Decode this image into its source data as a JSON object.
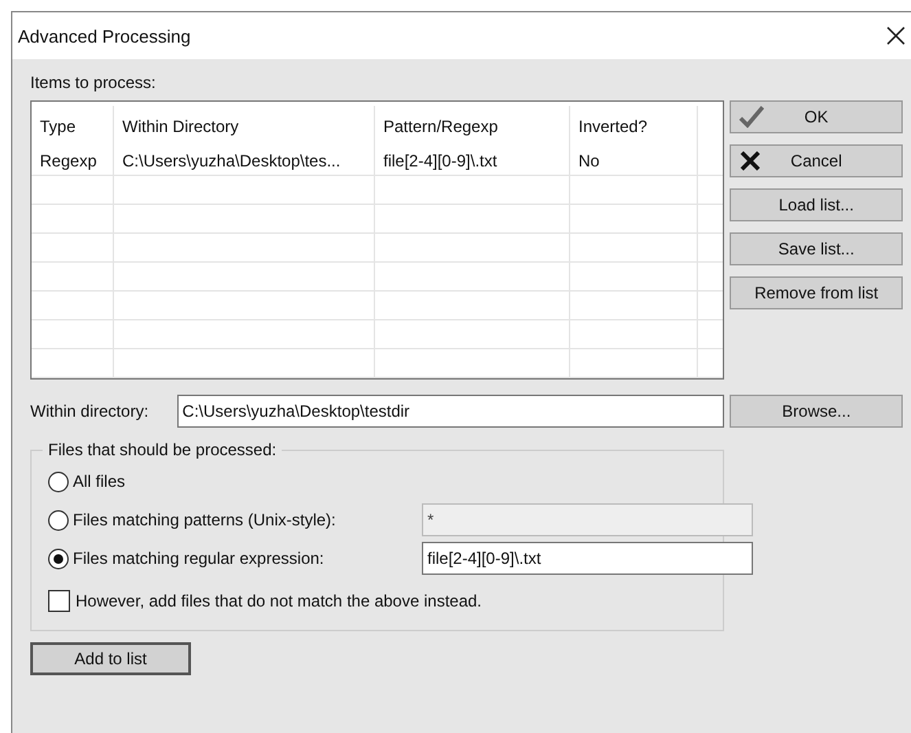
{
  "window": {
    "title": "Advanced Processing"
  },
  "items_label": "Items to process:",
  "table": {
    "columns": [
      "Type",
      "Within Directory",
      "Pattern/Regexp",
      "Inverted?"
    ],
    "rows": [
      [
        "Regexp",
        "C:\\Users\\yuzha\\Desktop\\tes...",
        "file[2-4][0-9]\\.txt",
        "No"
      ]
    ]
  },
  "side_buttons": [
    {
      "label": "OK",
      "kind": "ok"
    },
    {
      "label": "Cancel",
      "kind": "cancel"
    },
    {
      "label": "Load list...",
      "kind": "plain"
    },
    {
      "label": "Save list...",
      "kind": "plain"
    },
    {
      "label": "Remove from list",
      "kind": "plain"
    }
  ],
  "directory": {
    "label": "Within directory:",
    "value": "C:\\Users\\yuzha\\Desktop\\testdir",
    "button": "Browse..."
  },
  "group": {
    "legend": "Files that should be processed:",
    "options": [
      {
        "label": "All files",
        "selected": false
      },
      {
        "label": "Files matching patterns (Unix-style):",
        "selected": false,
        "field": {
          "value": "*",
          "disabled": true
        }
      },
      {
        "label": "Files matching regular expression:",
        "selected": true,
        "field": {
          "value": "file[2-4][0-9]\\.txt",
          "disabled": false
        }
      }
    ],
    "invert": {
      "label": "However, add files that do not match the above instead.",
      "checked": false
    }
  },
  "add_button": "Add to list"
}
